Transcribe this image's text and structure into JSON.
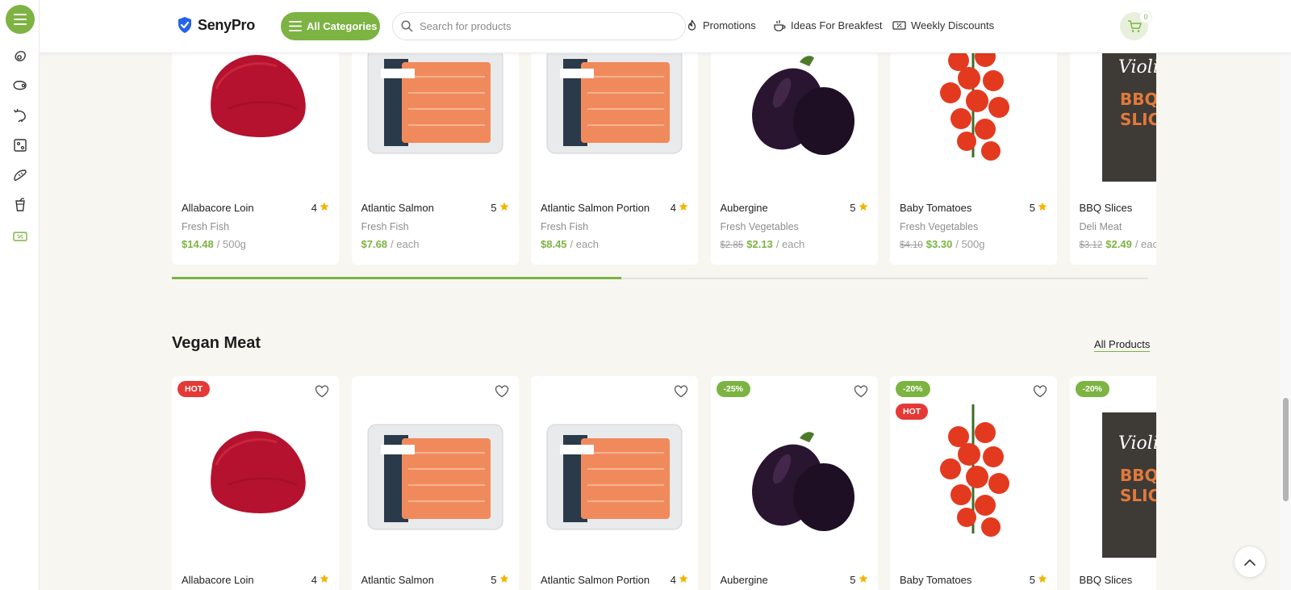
{
  "header": {
    "logo_text": "SenyPro",
    "categories_label": "All Categories",
    "search_placeholder": "Search for products",
    "nav": [
      "Promotions",
      "Ideas For Breakfest",
      "Weekly Discounts"
    ],
    "cart_count": "0"
  },
  "colors": {
    "accent": "#7cb342",
    "hot": "#e53935",
    "star": "#f4b400"
  },
  "top_row": {
    "progress_fraction": 0.46,
    "products": [
      {
        "name": "Allabacore Loin",
        "rating": "4",
        "category": "Fresh Fish",
        "old_price": "",
        "price": "$14.48",
        "unit": "/ 500g",
        "image": "tuna"
      },
      {
        "name": "Atlantic Salmon",
        "rating": "5",
        "category": "Fresh Fish",
        "old_price": "",
        "price": "$7.68",
        "unit": "/ each",
        "image": "salmon-pack"
      },
      {
        "name": "Atlantic Salmon Portion",
        "rating": "4",
        "category": "Fresh Fish",
        "old_price": "",
        "price": "$8.45",
        "unit": "/ each",
        "image": "salmon-pack"
      },
      {
        "name": "Aubergine",
        "rating": "5",
        "category": "Fresh Vegetables",
        "old_price": "$2.85",
        "price": "$2.13",
        "unit": "/ each",
        "image": "eggplant"
      },
      {
        "name": "Baby Tomatoes",
        "rating": "5",
        "category": "Fresh Vegetables",
        "old_price": "$4.10",
        "price": "$3.30",
        "unit": "/ 500g",
        "image": "tomatoes"
      },
      {
        "name": "BBQ Slices",
        "rating": "",
        "category": "Deli Meat",
        "old_price": "$3.12",
        "price": "$2.49",
        "unit": "/ each",
        "image": "violife-box"
      }
    ]
  },
  "vegan_section": {
    "title": "Vegan Meat",
    "all_products_label": "All Products",
    "products": [
      {
        "name": "Allabacore Loin",
        "rating": "4",
        "badges": [
          "HOT"
        ],
        "image": "tuna"
      },
      {
        "name": "Atlantic Salmon",
        "rating": "5",
        "badges": [],
        "image": "salmon-pack"
      },
      {
        "name": "Atlantic Salmon Portion",
        "rating": "4",
        "badges": [],
        "image": "salmon-pack"
      },
      {
        "name": "Aubergine",
        "rating": "5",
        "badges": [
          "-25%"
        ],
        "image": "eggplant"
      },
      {
        "name": "Baby Tomatoes",
        "rating": "5",
        "badges": [
          "-20%",
          "HOT"
        ],
        "image": "tomatoes"
      },
      {
        "name": "BBQ Slices",
        "rating": "",
        "badges": [
          "-20%"
        ],
        "image": "violife-box"
      }
    ]
  },
  "sidebar_icons": [
    "avocado-icon",
    "meat-icon",
    "shrimp-icon",
    "cheese-icon",
    "bread-icon",
    "drink-icon",
    "discount-icon"
  ]
}
